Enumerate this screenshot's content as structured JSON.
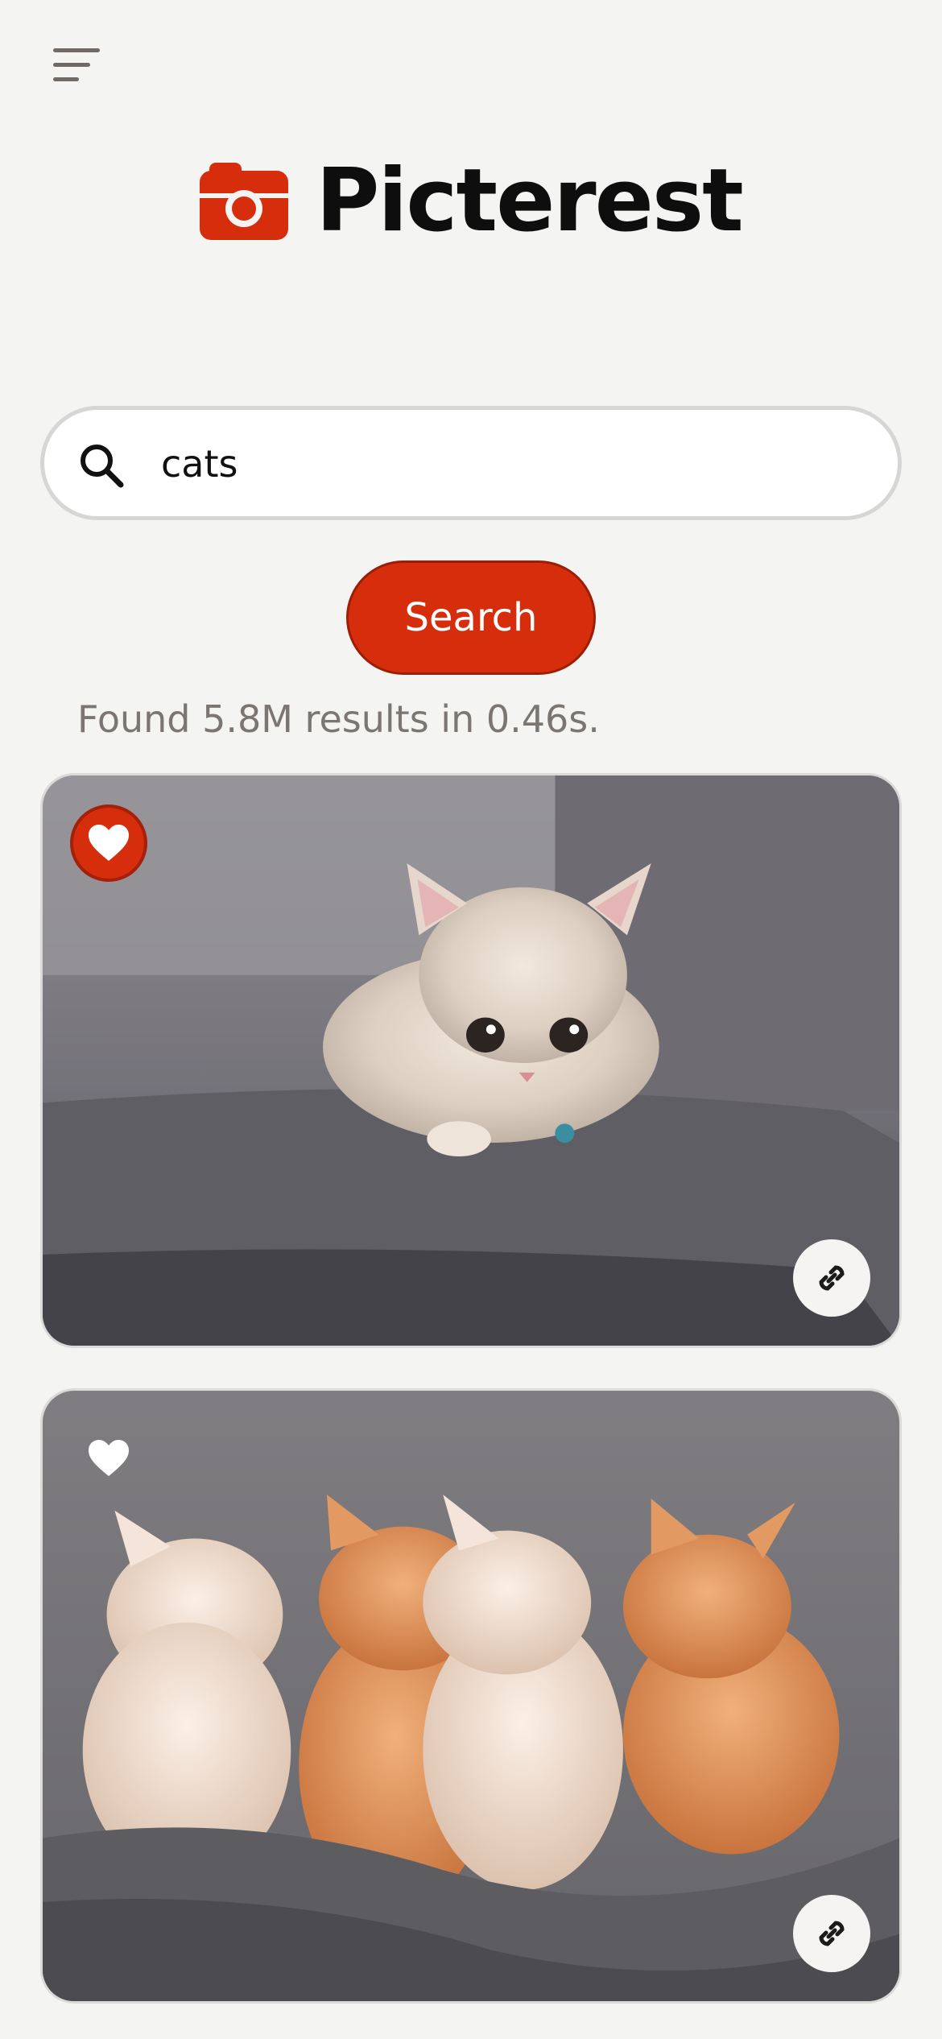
{
  "app": {
    "name": "Picterest",
    "accent_color": "#d62e0c",
    "menu_icon": "hamburger-menu-icon",
    "logo_icon": "camera-logo-icon"
  },
  "search": {
    "value": "cats",
    "icon": "search-icon",
    "button_label": "Search"
  },
  "results": {
    "summary": "Found 5.8M results in 0.46s.",
    "items": [
      {
        "subject": "grey-cream-kitten-on-sofa",
        "liked": true,
        "like_icon": "heart-icon",
        "link_icon": "link-icon"
      },
      {
        "subject": "four-kittens-sleeping-on-blanket",
        "liked": false,
        "like_icon": "heart-icon",
        "link_icon": "link-icon"
      }
    ]
  }
}
